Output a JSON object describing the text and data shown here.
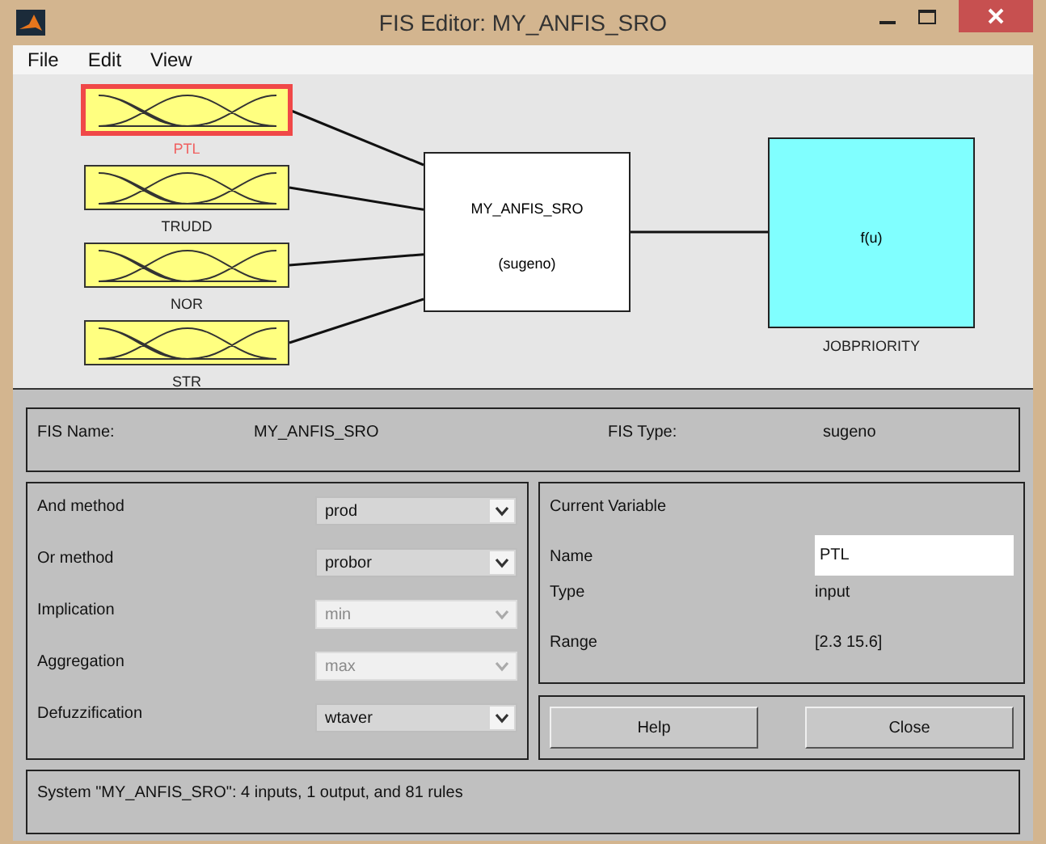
{
  "window": {
    "title": "FIS Editor: MY_ANFIS_SRO"
  },
  "menu": [
    "File",
    "Edit",
    "View"
  ],
  "inputs": [
    {
      "name": "PTL",
      "selected": true
    },
    {
      "name": "TRUDD",
      "selected": false
    },
    {
      "name": "NOR",
      "selected": false
    },
    {
      "name": "STR",
      "selected": false
    }
  ],
  "system": {
    "name": "MY_ANFIS_SRO",
    "type": "(sugeno)"
  },
  "output": {
    "name": "JOBPRIORITY",
    "function": "f(u)"
  },
  "fis_info": {
    "name_label": "FIS Name:",
    "name_value": "MY_ANFIS_SRO",
    "type_label": "FIS Type:",
    "type_value": "sugeno"
  },
  "methods": [
    {
      "label": "And method",
      "value": "prod",
      "disabled": false
    },
    {
      "label": "Or method",
      "value": "probor",
      "disabled": false
    },
    {
      "label": "Implication",
      "value": "min",
      "disabled": true
    },
    {
      "label": "Aggregation",
      "value": "max",
      "disabled": true
    },
    {
      "label": "Defuzzification",
      "value": "wtaver",
      "disabled": false
    }
  ],
  "current_variable": {
    "title": "Current Variable",
    "name_label": "Name",
    "name_value": "PTL",
    "type_label": "Type",
    "type_value": "input",
    "range_label": "Range",
    "range_value": "[2.3 15.6]"
  },
  "buttons": [
    "Help",
    "Close"
  ],
  "status": "System \"MY_ANFIS_SRO\": 4 inputs, 1 output, and 81 rules"
}
